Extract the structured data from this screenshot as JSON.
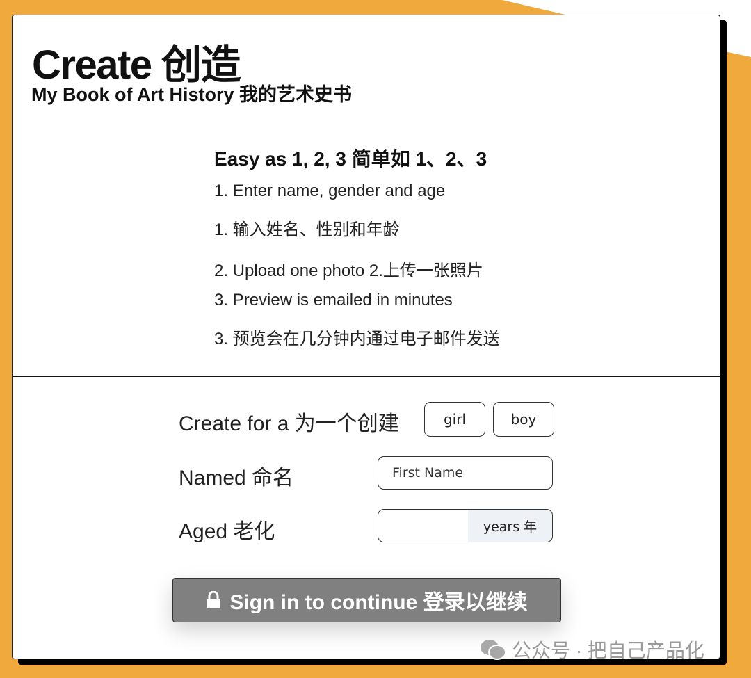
{
  "colors": {
    "background": "#F0A93C",
    "button": "#808080",
    "unit_bg": "#EEF1F5"
  },
  "header": {
    "title": "Create 创造",
    "subtitle": "My Book of Art History 我的艺术史书"
  },
  "steps": {
    "heading": "Easy as 1, 2, 3 简单如 1、2、3",
    "items": [
      "1. Enter name, gender and age",
      "1. 输入姓名、性别和年龄",
      "2. Upload one photo  2.上传一张照片",
      "3. Preview is emailed in minutes",
      "3. 预览会在几分钟内通过电子邮件发送"
    ]
  },
  "form": {
    "create_for_label": "Create for a  为一个创建",
    "girl_label": "girl",
    "boy_label": "boy",
    "named_label": "Named 命名",
    "name_placeholder": "First Name",
    "name_value": "",
    "aged_label": "Aged 老化",
    "age_value": "",
    "age_unit": "years  年",
    "signin_label": "Sign in to continue 登录以继续",
    "signin_icon": "lock-icon"
  },
  "watermark": {
    "text": "公众号 · 把自己产品化",
    "icon": "wechat-icon"
  }
}
